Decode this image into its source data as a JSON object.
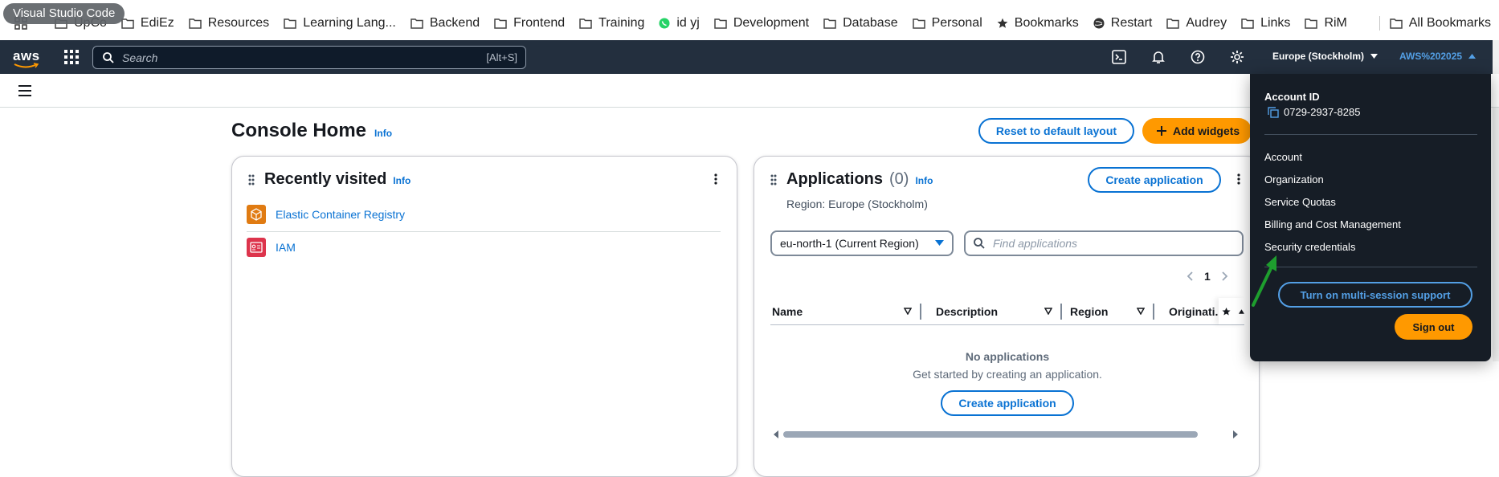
{
  "tooltip": "Visual Studio Code",
  "bookmarks": {
    "items": [
      {
        "label": "UpCo",
        "icon": "folder-icon"
      },
      {
        "label": "EdiEz",
        "icon": "folder-icon"
      },
      {
        "label": "Resources",
        "icon": "folder-icon"
      },
      {
        "label": "Learning Lang...",
        "icon": "folder-icon"
      },
      {
        "label": "Backend",
        "icon": "folder-icon"
      },
      {
        "label": "Frontend",
        "icon": "folder-icon"
      },
      {
        "label": "Training",
        "icon": "folder-icon"
      },
      {
        "label": "id yj",
        "icon": "whatsapp-icon"
      },
      {
        "label": "Development",
        "icon": "folder-icon"
      },
      {
        "label": "Database",
        "icon": "folder-icon"
      },
      {
        "label": "Personal",
        "icon": "folder-icon"
      },
      {
        "label": "Bookmarks",
        "icon": "star-icon"
      },
      {
        "label": "Restart",
        "icon": "globe-icon"
      },
      {
        "label": "Audrey",
        "icon": "folder-icon"
      },
      {
        "label": "Links",
        "icon": "folder-icon"
      },
      {
        "label": "RiM",
        "icon": "folder-icon"
      }
    ],
    "all_label": "All Bookmarks"
  },
  "nav": {
    "logo": "aws",
    "search_placeholder": "Search",
    "search_shortcut": "[Alt+S]",
    "region": "Europe (Stockholm)",
    "account": "AWS%202025"
  },
  "page": {
    "title": "Console Home",
    "info": "Info",
    "reset_button": "Reset to default layout",
    "add_widgets_button": "Add widgets"
  },
  "recently_visited": {
    "title": "Recently visited",
    "info": "Info",
    "items": [
      {
        "label": "Elastic Container Registry",
        "color": "#e07b12"
      },
      {
        "label": "IAM",
        "color": "#dd344c"
      }
    ]
  },
  "applications": {
    "title": "Applications",
    "count": "(0)",
    "info": "Info",
    "create_button": "Create application",
    "region_text": "Region: Europe (Stockholm)",
    "region_select": "eu-north-1 (Current Region)",
    "find_placeholder": "Find applications",
    "page": "1",
    "columns": [
      "Name",
      "Description",
      "Region",
      "Originati..."
    ],
    "empty_title": "No applications",
    "empty_desc": "Get started by creating an application.",
    "empty_button": "Create application"
  },
  "account_menu": {
    "account_id_label": "Account ID",
    "account_id": "0729-2937-8285",
    "items": [
      "Account",
      "Organization",
      "Service Quotas",
      "Billing and Cost Management",
      "Security credentials"
    ],
    "multi_session_button": "Turn on multi-session support",
    "sign_out_button": "Sign out"
  },
  "colors": {
    "nav_bg": "#232f3e",
    "link_blue": "#0972d3",
    "accent_orange": "#ff9900",
    "dropdown_bg": "#161d26",
    "annotation_arrow": "#1e9e2e"
  }
}
